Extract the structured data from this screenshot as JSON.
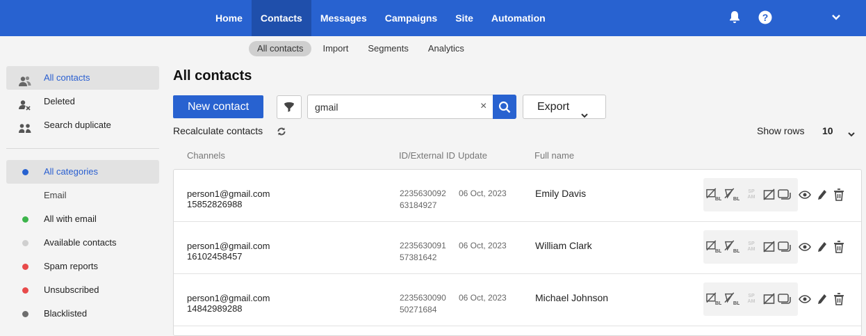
{
  "topnav": {
    "items": [
      "Home",
      "Contacts",
      "Messages",
      "Campaigns",
      "Site",
      "Automation"
    ],
    "active": "Contacts"
  },
  "subnav": {
    "items": [
      "All contacts",
      "Import",
      "Segments",
      "Analytics"
    ],
    "active": "All contacts"
  },
  "sidebar": {
    "items": [
      {
        "label": "All contacts",
        "icon": "users-icon"
      },
      {
        "label": "Deleted",
        "icon": "user-delete-icon"
      },
      {
        "label": "Search duplicate",
        "icon": "duplicate-users-icon"
      }
    ],
    "categories_label": "All categories",
    "email_head": "Email",
    "email_items": [
      {
        "label": "All with email",
        "color": "#3cb44b"
      },
      {
        "label": "Available contacts",
        "color": "#cfcfcf"
      },
      {
        "label": "Spam reports",
        "color": "#e84a4a"
      },
      {
        "label": "Unsubscribed",
        "color": "#e84a4a"
      },
      {
        "label": "Blacklisted",
        "color": "#6d6d6d"
      }
    ]
  },
  "main": {
    "title": "All contacts",
    "new_contact": "New contact",
    "search_value": "gmail",
    "clear": "×",
    "export": "Export",
    "recalculate": "Recalculate contacts",
    "show_rows_label": "Show rows",
    "show_rows_value": "10"
  },
  "table": {
    "columns": [
      "Channels",
      "ID/External ID",
      "Update",
      "Full name"
    ],
    "rows": [
      {
        "email": "person1@gmail.com",
        "phone": "15852826988",
        "id": "2235630092",
        "ext_id": "63184927",
        "update": "06 Oct, 2023",
        "name": "Emily Davis"
      },
      {
        "email": "person1@gmail.com",
        "phone": "16102458457",
        "id": "2235630091",
        "ext_id": "57381642",
        "update": "06 Oct, 2023",
        "name": "William Clark"
      },
      {
        "email": "person1@gmail.com",
        "phone": "14842989288",
        "id": "2235630090",
        "ext_id": "50271684",
        "update": "06 Oct, 2023",
        "name": "Michael Johnson"
      }
    ],
    "spam_badge": [
      "SP",
      "AM"
    ],
    "bl_badge": "BL"
  },
  "colors": {
    "brand": "#2862d0",
    "brand_dark": "#1f4fab",
    "active_text": "#2a5fd0"
  }
}
